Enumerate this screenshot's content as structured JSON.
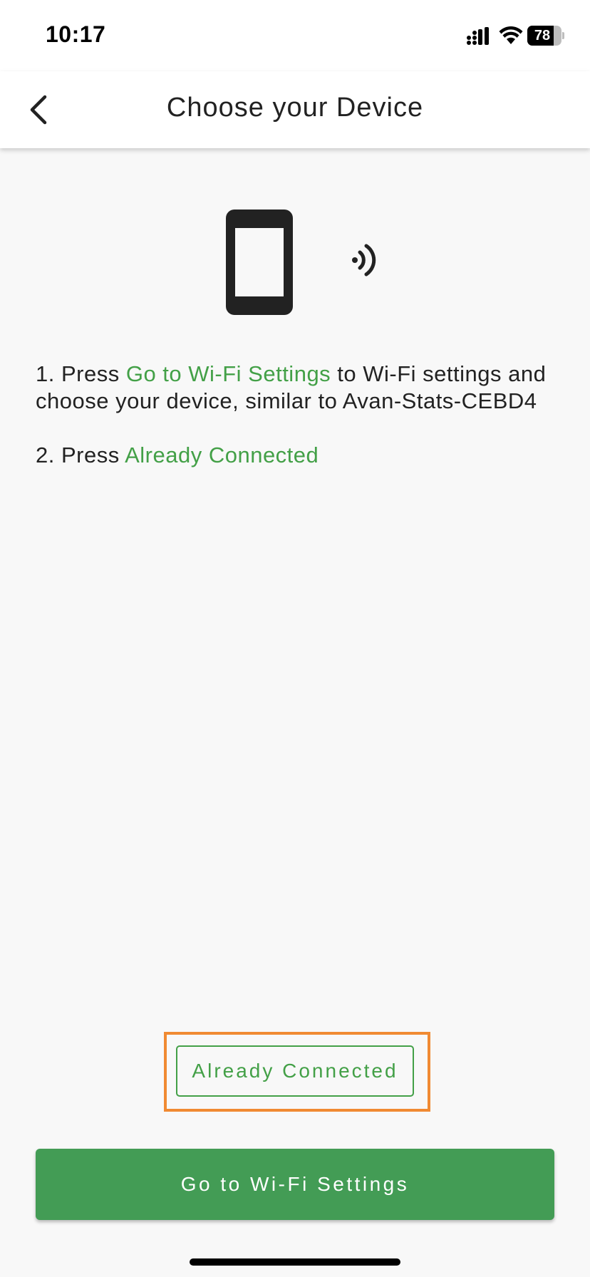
{
  "status_bar": {
    "time": "10:17",
    "battery_percent": "78",
    "battery_level": 0.78
  },
  "header": {
    "title": "Choose your Device",
    "back_icon": "chevron-left-icon"
  },
  "illustration": {
    "device_icon": "smartphone-icon",
    "signal_icon": "signal-waves-icon"
  },
  "instructions": {
    "step1_prefix": "1. Press ",
    "step1_highlight": "Go to Wi-Fi Settings",
    "step1_suffix": " to Wi-Fi settings and choose your device, similar to Avan-Stats-CEBD4",
    "step2_prefix": "2. Press ",
    "step2_highlight": "Already Connected"
  },
  "buttons": {
    "already_connected": "Already Connected",
    "wifi_settings": "Go to Wi-Fi Settings"
  },
  "colors": {
    "accent_green": "#43a047",
    "primary_button": "#439c55",
    "highlight_frame": "#f08a32",
    "background": "#f8f8f8"
  }
}
